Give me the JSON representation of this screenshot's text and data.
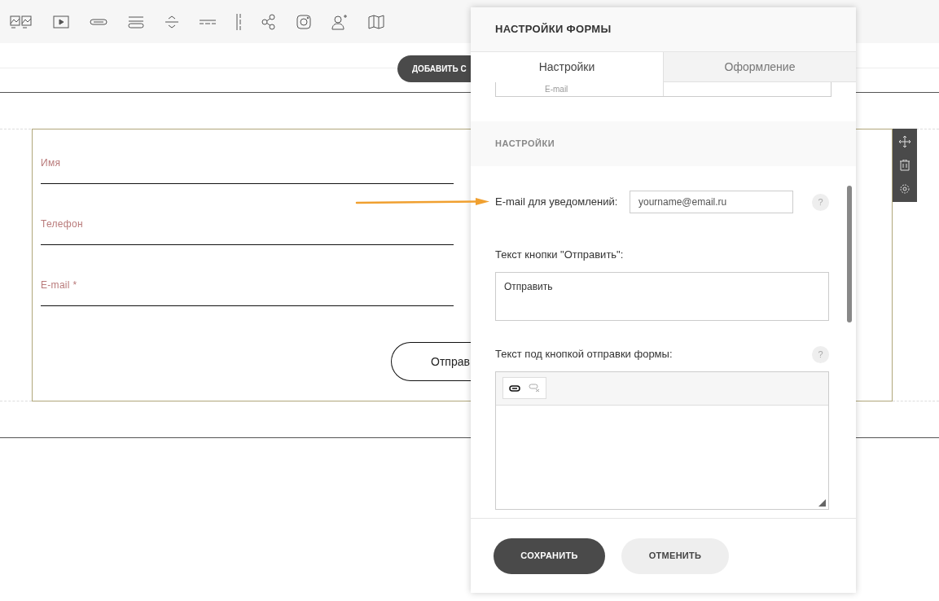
{
  "add_block_button": "ДОБАВИТЬ С",
  "form_preview": {
    "fields": [
      {
        "label": "Имя"
      },
      {
        "label": "Телефон"
      },
      {
        "label": "E-mail *"
      }
    ],
    "submit_button": "Отправ"
  },
  "panel": {
    "title": "НАСТРОЙКИ ФОРМЫ",
    "tabs": [
      {
        "label": "Настройки",
        "selected": true
      },
      {
        "label": "Оформление",
        "selected": false
      }
    ],
    "field_row": "E-mail",
    "section_title": "НАСТРОЙКИ",
    "email_field": {
      "label": "E-mail для уведомлений:",
      "placeholder": "yourname@email.ru",
      "help": "?"
    },
    "button_text_field": {
      "label": "Текст кнопки \"Отправить\":",
      "value": "Отправить"
    },
    "below_text_field": {
      "label": "Текст под кнопкой отправки формы:",
      "help": "?"
    },
    "buttons": [
      {
        "label": "СОХРАНИТЬ",
        "kind": "primary"
      },
      {
        "label": "ОТМЕНИТЬ",
        "kind": "secondary"
      }
    ]
  }
}
